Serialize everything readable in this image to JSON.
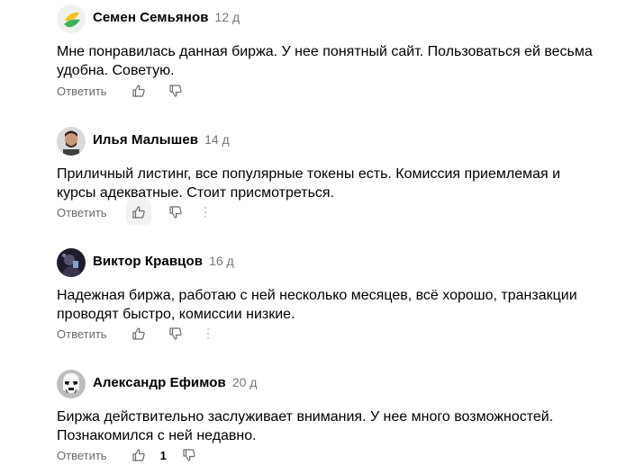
{
  "comments": [
    {
      "author": "Семен Семьянов",
      "date": "12 д",
      "text": "Мне понравилась данная биржа. У нее понятный сайт. Пользоваться ей весьма удобна. Советую.",
      "reply_label": "Ответить",
      "avatar_icon": "green-yellow-leaf-avatar",
      "like_count": ""
    },
    {
      "author": "Илья Малышев",
      "date": "14 д",
      "text": "Приличный листинг, все популярные токены есть. Комиссия приемлемая и курсы адекватные. Стоит присмотреться.",
      "reply_label": "Ответить",
      "avatar_icon": "man-photo-avatar",
      "like_count": ""
    },
    {
      "author": "Виктор Кравцов",
      "date": "16 д",
      "text": "Надежная биржа, работаю с ней несколько месяцев, всё хорошо, транзакции проводят быстро, комиссии низкие.",
      "reply_label": "Ответить",
      "avatar_icon": "dark-photo-avatar",
      "like_count": ""
    },
    {
      "author": "Александр Ефимов",
      "date": "20 д",
      "text": "Биржа действительно заслуживает внимания. У нее много возможностей. Познакомился с ней недавно.",
      "reply_label": "Ответить",
      "avatar_icon": "stormtrooper-avatar",
      "like_count": "1"
    }
  ],
  "colors": {
    "text": "#000000",
    "muted": "#767676",
    "icon": "#6b6b6b"
  }
}
